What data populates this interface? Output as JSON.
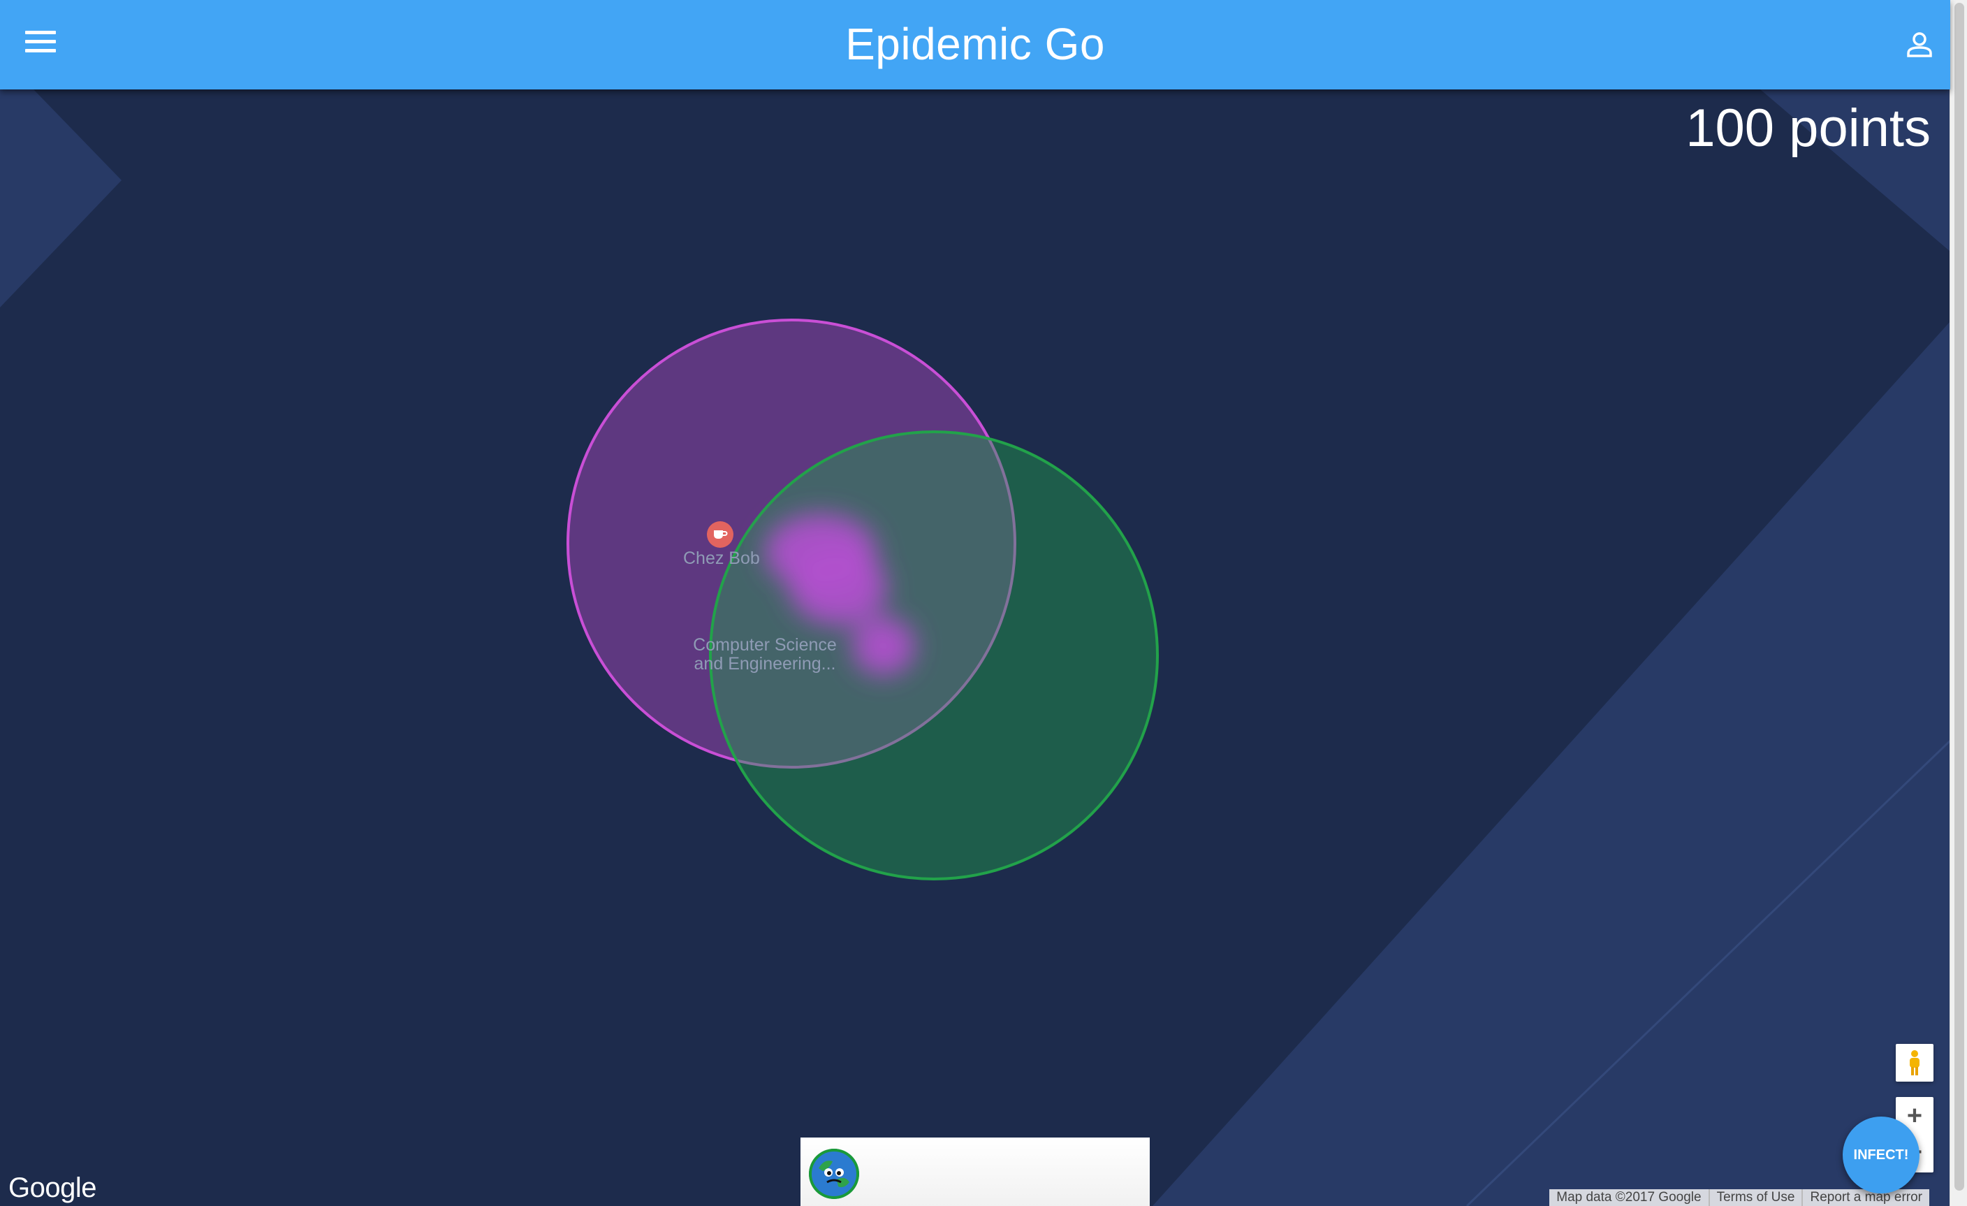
{
  "app": {
    "title": "Epidemic Go"
  },
  "score": {
    "text": "100 points"
  },
  "map": {
    "pois": [
      {
        "name": "Chez Bob",
        "icon": "cafe-icon"
      },
      {
        "name_line1": "Computer Science",
        "name_line2": "and Engineering..."
      }
    ],
    "zones": [
      {
        "color": "#c94fd6",
        "label": ""
      },
      {
        "color": "#22a24a",
        "label": ""
      }
    ],
    "logo": "Google",
    "attribution": [
      "Map data ©2017 Google",
      "Terms of Use",
      "Report a map error"
    ],
    "controls": {
      "zoom_in": "+",
      "zoom_out": "−"
    }
  },
  "actions": {
    "infect_label": "INFECT!"
  },
  "colors": {
    "header": "#42a5f5",
    "map_bg": "#1d2b4c",
    "accent": "#3d9ff0"
  }
}
